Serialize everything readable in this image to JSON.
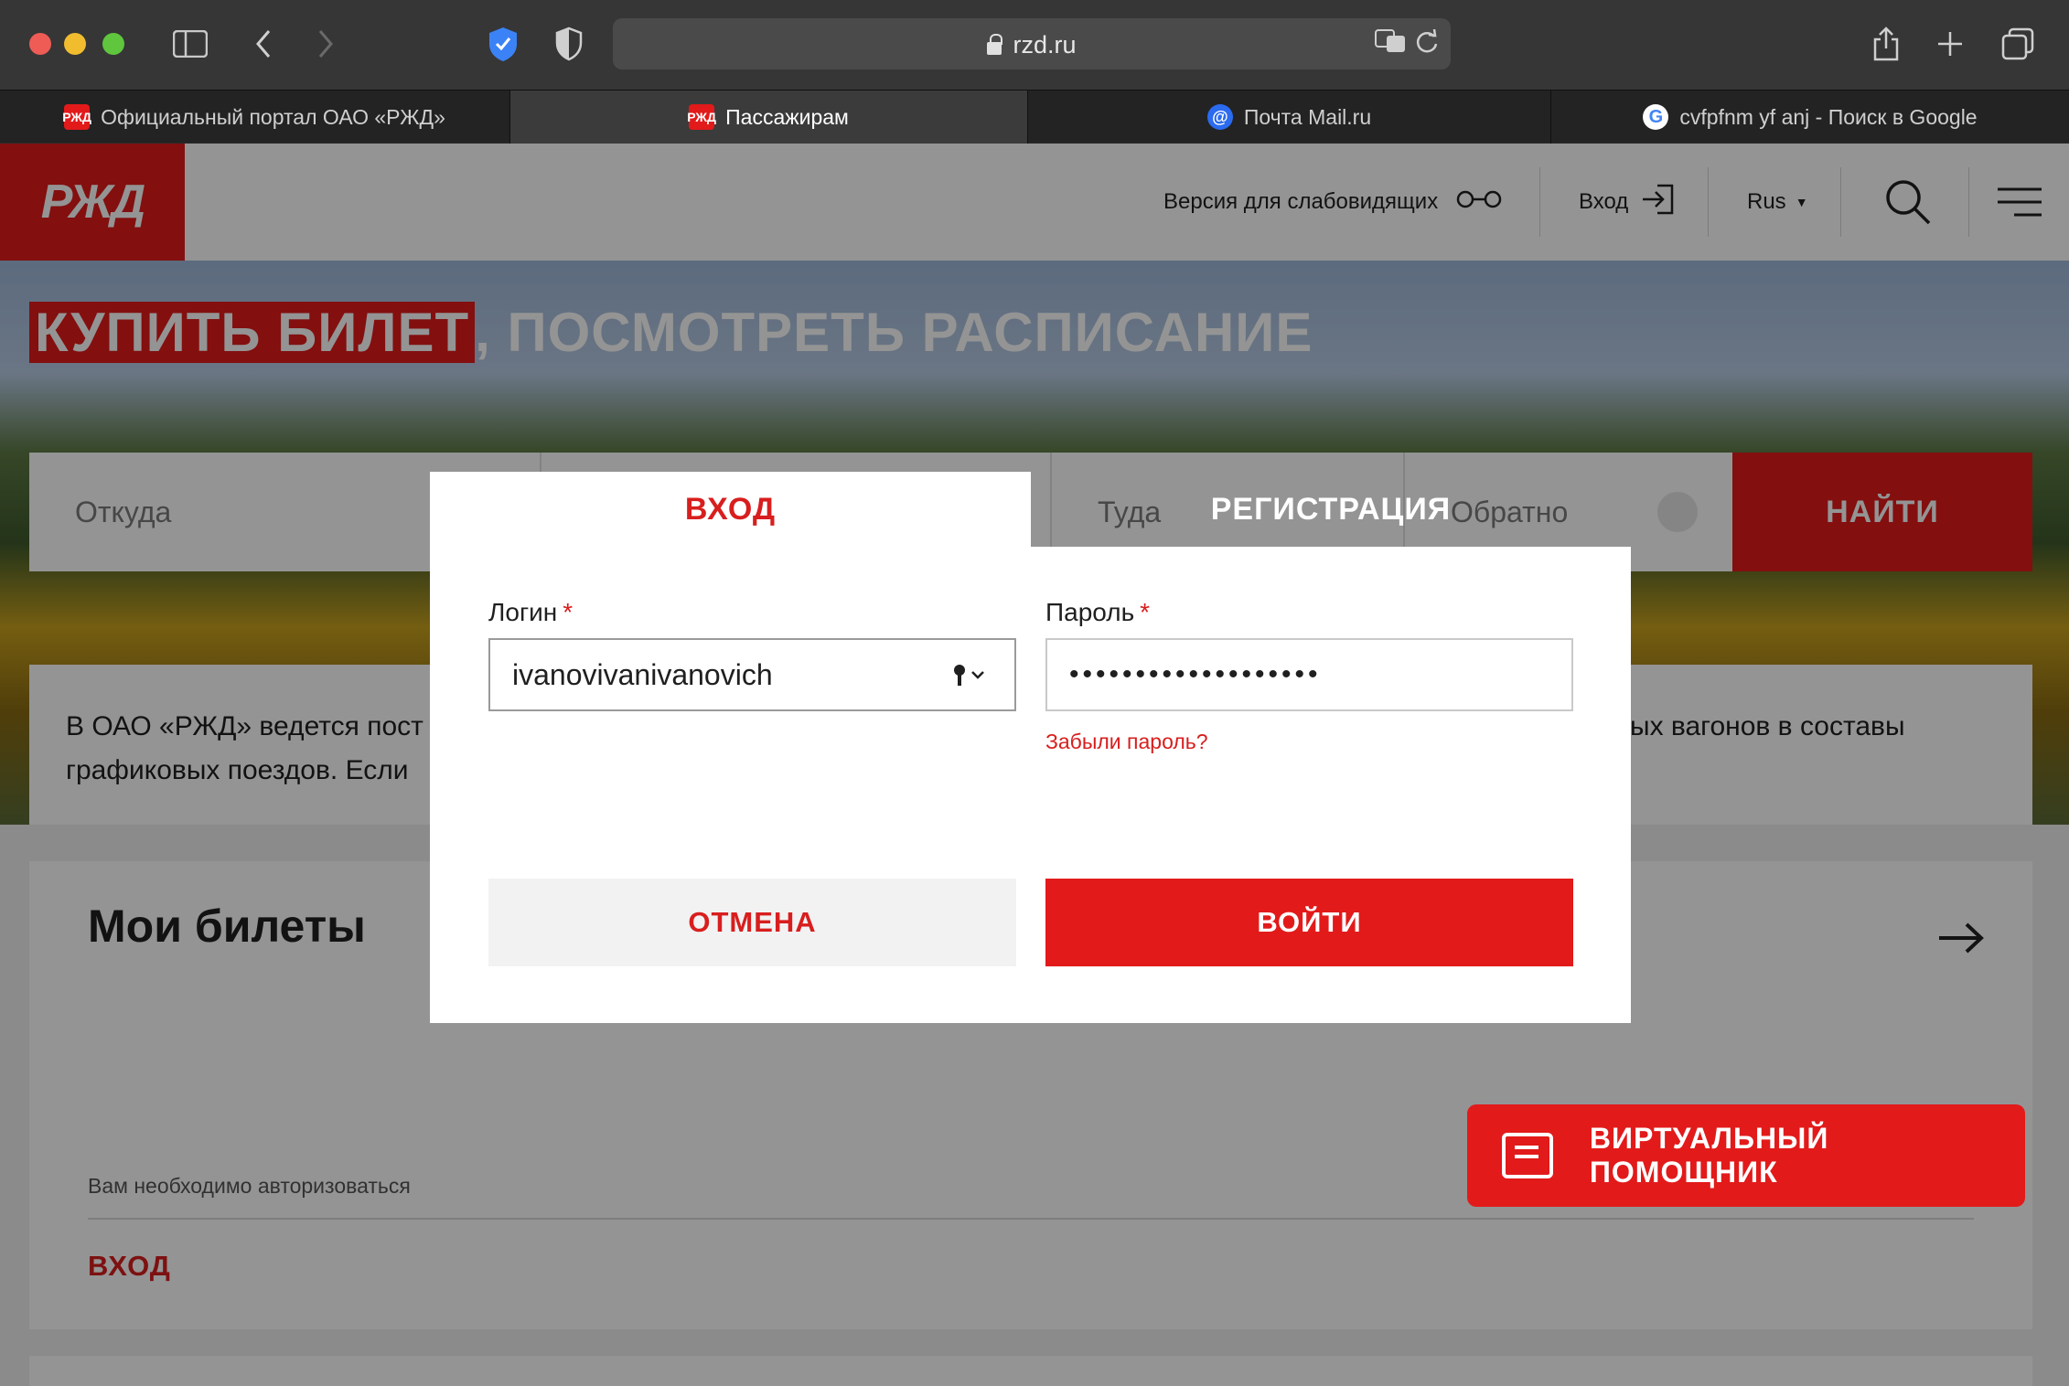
{
  "browser": {
    "url": "rzd.ru",
    "tabs": [
      {
        "label": "Официальный портал ОАО «РЖД»",
        "favicon": "rzd-favicon"
      },
      {
        "label": "Пассажирам",
        "favicon": "rzd-favicon",
        "active": true
      },
      {
        "label": "Почта Mail.ru",
        "favicon": "mail-favicon"
      },
      {
        "label": "cvfpfnm yf anj - Поиск в Google",
        "favicon": "google-favicon"
      }
    ],
    "favicon_text": {
      "rzd": "РЖД",
      "mail": "@",
      "google": "G"
    }
  },
  "header": {
    "logo": "РЖД",
    "accessibility_label": "Версия для слабовидящих",
    "login_label": "Вход",
    "language": "Rus"
  },
  "hero": {
    "title_highlight": "КУПИТЬ БИЛЕТ",
    "title_rest": ", ПОСМОТРЕТЬ РАСПИСАНИЕ",
    "from_placeholder": "Откуда",
    "to_placeholder": "Туда",
    "back_placeholder": "Обратно",
    "search_button": "НАЙТИ"
  },
  "notice": {
    "line1_start": "В ОАО «РЖД» ведется пост",
    "line1_end": "ых вагонов в составы",
    "line2_start": "графиковых поездов. Если"
  },
  "tickets_card": {
    "title": "Мои билеты",
    "note": "Вам необходимо авторизоваться",
    "login_link": "ВХОД"
  },
  "assistant": {
    "label": "ВИРТУАЛЬНЫЙ ПОМОЩНИК"
  },
  "modal": {
    "tab_login": "ВХОД",
    "tab_register": "РЕГИСТРАЦИЯ",
    "login_label": "Логин",
    "password_label": "Пароль",
    "required_mark": "*",
    "login_value": "ivanovivanivanovich",
    "password_value": "•••••••••••••••••••",
    "forgot_link": "Забыли пароль?",
    "cancel_button": "ОТМЕНА",
    "submit_button": "ВОЙТИ"
  },
  "colors": {
    "brand_red": "#e21a1a",
    "link_red": "#d81e1e"
  }
}
